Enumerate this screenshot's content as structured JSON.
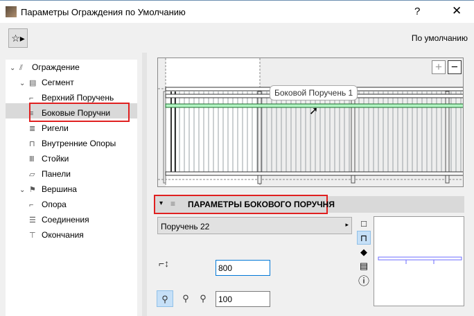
{
  "window": {
    "title": "Параметры Ограждения по Умолчанию",
    "help": "?",
    "close": "✕"
  },
  "toolbar": {
    "favorites_icon": "☆▸",
    "default_label": "По умолчанию"
  },
  "tree": [
    {
      "label": "Ограждение",
      "level": 0,
      "chev": "⌄",
      "icon": "⫽"
    },
    {
      "label": "Сегмент",
      "level": 1,
      "chev": "⌄",
      "icon": "▤"
    },
    {
      "label": "Верхний Поручень",
      "level": 2,
      "icon": "⌐"
    },
    {
      "label": "Боковые Поручни",
      "level": 2,
      "icon": "≡",
      "selected": true
    },
    {
      "label": "Ригели",
      "level": 2,
      "icon": "≣"
    },
    {
      "label": "Внутренние Опоры",
      "level": 2,
      "icon": "⊓"
    },
    {
      "label": "Стойки",
      "level": 2,
      "icon": "Ⅲ"
    },
    {
      "label": "Панели",
      "level": 2,
      "icon": "▱"
    },
    {
      "label": "Вершина",
      "level": 1,
      "chev": "⌄",
      "icon": "⚑"
    },
    {
      "label": "Опора",
      "level": 2,
      "icon": "⌐"
    },
    {
      "label": "Соединения",
      "level": 2,
      "icon": "☰"
    },
    {
      "label": "Окончания",
      "level": 2,
      "icon": "⊤"
    }
  ],
  "preview": {
    "tooltip": "Боковой Поручень 1",
    "zoom_in": "+",
    "zoom_out": "−",
    "highlight": "#b3f5c4"
  },
  "section": {
    "title": "ПАРАМЕТРЫ БОКОВОГО ПОРУЧНЯ",
    "arrow": "▾"
  },
  "profile": {
    "value": "Поручень 22",
    "arrow": "▸"
  },
  "fields": {
    "height": "800",
    "offset": "100"
  },
  "side_icons": [
    "□",
    "⊓",
    "◆",
    "▤",
    "ⓘ"
  ]
}
